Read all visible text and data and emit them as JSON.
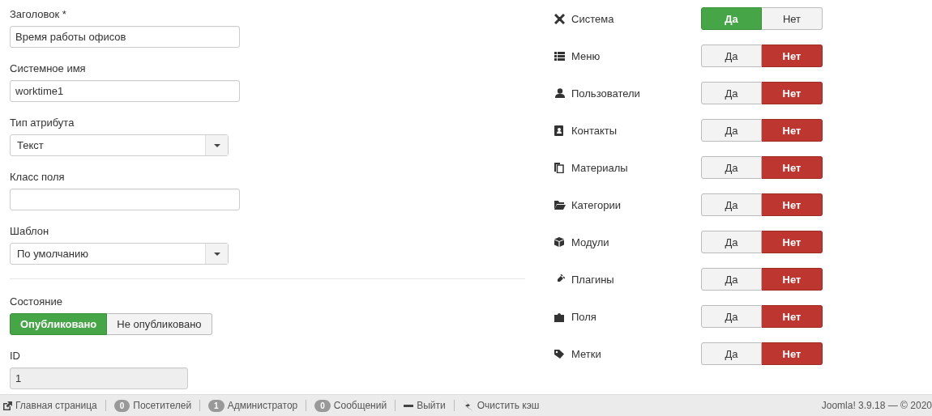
{
  "form": {
    "fields": [
      {
        "kind": "text",
        "label": "Заголовок *",
        "value": "Время работы офисов"
      },
      {
        "kind": "text",
        "label": "Системное имя",
        "value": "worktime1"
      },
      {
        "kind": "select",
        "label": "Тип атрибута",
        "value": "Текст"
      },
      {
        "kind": "text",
        "label": "Класс поля"
      },
      {
        "kind": "select",
        "label": "Шаблон",
        "value": "По умолчанию"
      }
    ],
    "state": {
      "label": "Состояние",
      "options": [
        {
          "label": "Опубликовано",
          "selected": true
        },
        {
          "label": "Не опубликовано",
          "selected": false
        }
      ]
    },
    "id": {
      "label": "ID",
      "value": "1",
      "disabled": true
    }
  },
  "sections": [
    {
      "label": "Система",
      "options": [
        {
          "label": "Да",
          "kind": "yes",
          "selected": true
        },
        {
          "label": "Нет",
          "kind": "no",
          "selected": false
        }
      ]
    },
    {
      "label": "Меню",
      "options": [
        {
          "label": "Да",
          "kind": "yes",
          "selected": false
        },
        {
          "label": "Нет",
          "kind": "no",
          "selected": true
        }
      ]
    },
    {
      "label": "Пользователи",
      "options": [
        {
          "label": "Да",
          "kind": "yes",
          "selected": false
        },
        {
          "label": "Нет",
          "kind": "no",
          "selected": true
        }
      ]
    },
    {
      "label": "Контакты",
      "options": [
        {
          "label": "Да",
          "kind": "yes",
          "selected": false
        },
        {
          "label": "Нет",
          "kind": "no",
          "selected": true
        }
      ]
    },
    {
      "label": "Материалы",
      "options": [
        {
          "label": "Да",
          "kind": "yes",
          "selected": false
        },
        {
          "label": "Нет",
          "kind": "no",
          "selected": true
        }
      ]
    },
    {
      "label": "Категории",
      "options": [
        {
          "label": "Да",
          "kind": "yes",
          "selected": false
        },
        {
          "label": "Нет",
          "kind": "no",
          "selected": true
        }
      ]
    },
    {
      "label": "Модули",
      "options": [
        {
          "label": "Да",
          "kind": "yes",
          "selected": false
        },
        {
          "label": "Нет",
          "kind": "no",
          "selected": true
        }
      ]
    },
    {
      "label": "Плагины",
      "options": [
        {
          "label": "Да",
          "kind": "yes",
          "selected": false
        },
        {
          "label": "Нет",
          "kind": "no",
          "selected": true
        }
      ]
    },
    {
      "label": "Поля",
      "options": [
        {
          "label": "Да",
          "kind": "yes",
          "selected": false
        },
        {
          "label": "Нет",
          "kind": "no",
          "selected": true
        }
      ]
    },
    {
      "label": "Метки",
      "options": [
        {
          "label": "Да",
          "kind": "yes",
          "selected": false
        },
        {
          "label": "Нет",
          "kind": "no",
          "selected": true
        }
      ]
    }
  ],
  "status_bar": {
    "items": [
      {
        "kind": "link",
        "label": "Главная страница"
      },
      {
        "kind": "count",
        "count": "0",
        "label": "Посетителей"
      },
      {
        "kind": "count",
        "count": "1",
        "label": "Администратор"
      },
      {
        "kind": "count",
        "count": "0",
        "label": "Сообщений"
      },
      {
        "kind": "logout",
        "label": "Выйти"
      },
      {
        "kind": "clear",
        "label": "Очистить кэш"
      }
    ],
    "version": "Joomla! 3.9.18  —  © 2020"
  }
}
